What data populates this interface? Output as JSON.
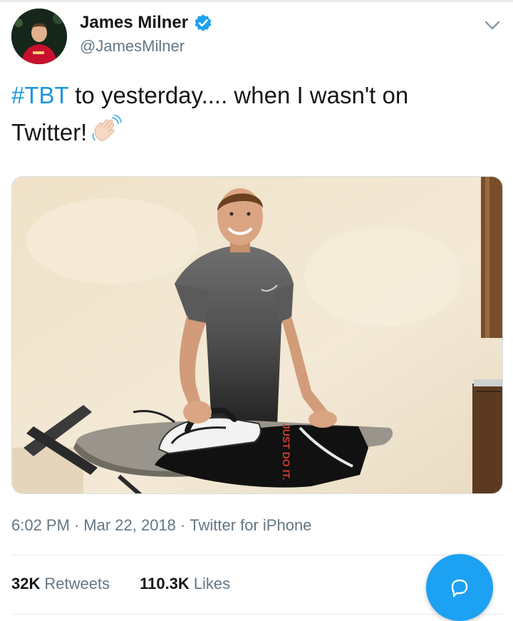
{
  "author": {
    "display_name": "James Milner",
    "handle": "@JamesMilner",
    "verified": true
  },
  "tweet": {
    "hashtag": "#TBT",
    "text_line1": " to yesterday.... when I wasn't on",
    "text_line2": "Twitter!",
    "emoji": "waving-hand-icon"
  },
  "media": {
    "shirt_print": "JUST DO IT."
  },
  "meta": {
    "time": "6:02 PM",
    "date": "Mar 22, 2018",
    "source": "Twitter for iPhone",
    "separator": "·"
  },
  "stats": {
    "retweets_count": "32K",
    "retweets_label": "Retweets",
    "likes_count": "110.3K",
    "likes_label": "Likes"
  },
  "icons": {
    "menu": "chevron-down-icon",
    "compose": "reply-bubble-icon"
  },
  "colors": {
    "accent": "#1da1f2",
    "hashtag": "#1b95e0",
    "secondary_text": "#657786",
    "divider": "#e6ecf0"
  }
}
